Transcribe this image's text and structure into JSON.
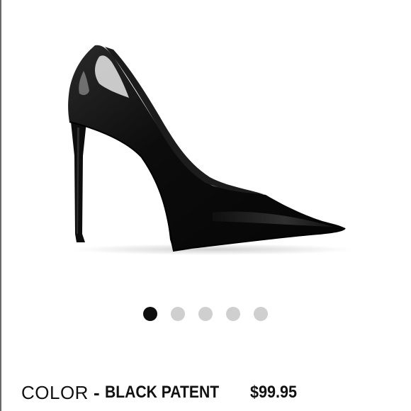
{
  "product": {
    "image_alt": "black patent pointed-toe stiletto pump",
    "color_label": "COLOR",
    "separator": "-",
    "color_value": "BLACK PATENT",
    "price": "$99.95"
  },
  "carousel": {
    "total": 5,
    "active_index": 0,
    "active_color": "#0e0e0e",
    "inactive_color": "#cfcfcf"
  }
}
